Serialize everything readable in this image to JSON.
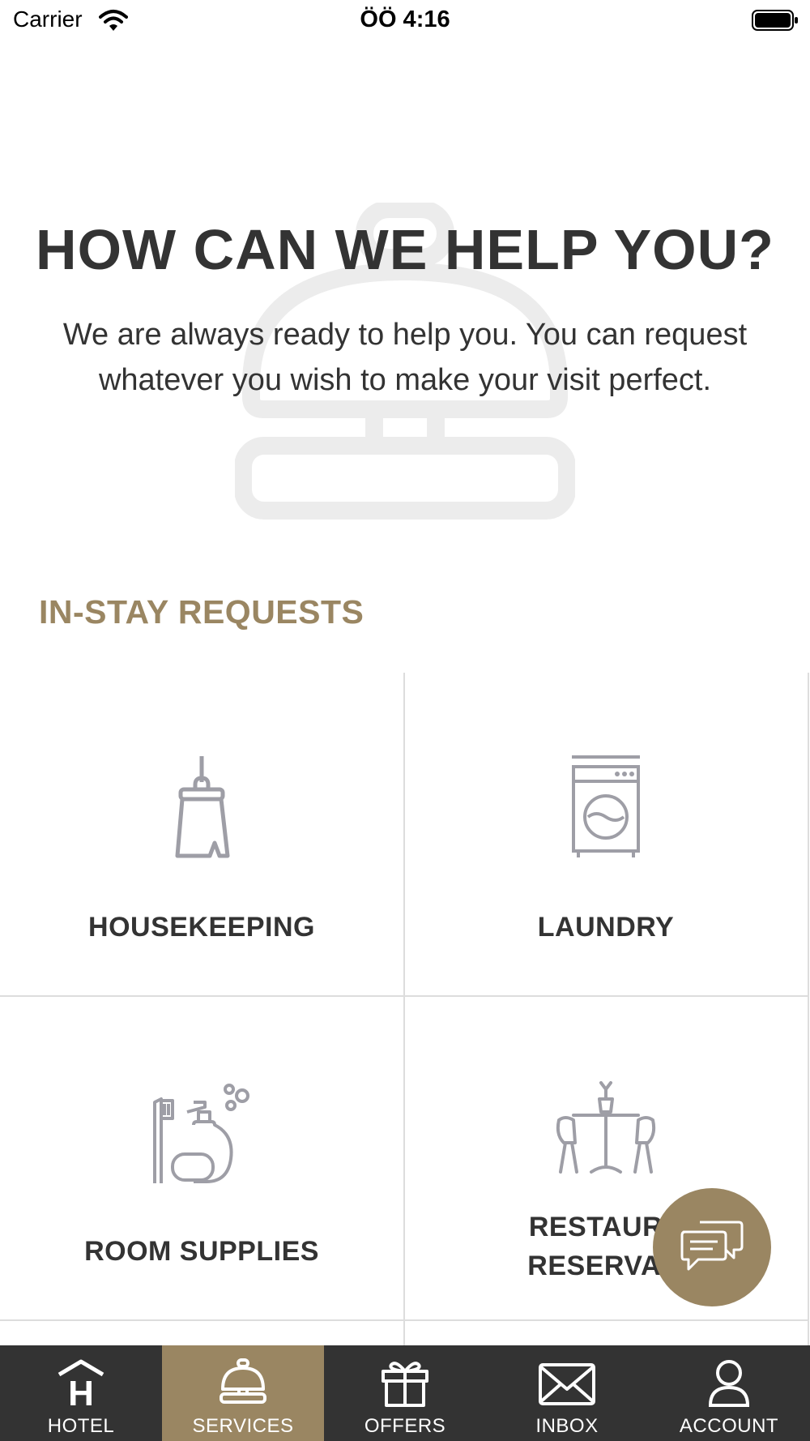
{
  "status_bar": {
    "carrier": "Carrier",
    "time": "ÖÖ 4:16",
    "wifi_icon": "wifi-icon",
    "battery_icon": "battery-icon"
  },
  "hero": {
    "title": "HOW CAN WE HELP YOU?",
    "text": "We are always ready to help you. You can request whatever you wish to make your visit perfect.",
    "background_icon": "service-bell-icon"
  },
  "section": {
    "title": "IN-STAY REQUESTS"
  },
  "tiles": [
    {
      "label": "HOUSEKEEPING",
      "icon": "broom-icon"
    },
    {
      "label": "LAUNDRY",
      "icon": "washing-machine-icon"
    },
    {
      "label": "ROOM SUPPLIES",
      "icon": "toiletries-icon"
    },
    {
      "label": "RESTAURANT RESERVATION",
      "label_line1": "RESTAURA",
      "label_line2": "RESERVATI",
      "icon": "dining-table-icon"
    }
  ],
  "chat_fab": {
    "icon": "chat-bubbles-icon"
  },
  "tab_bar": {
    "items": [
      {
        "label": "HOTEL",
        "icon": "hotel-icon",
        "active": false
      },
      {
        "label": "SERVICES",
        "icon": "service-bell-icon",
        "active": true
      },
      {
        "label": "OFFERS",
        "icon": "gift-icon",
        "active": false
      },
      {
        "label": "INBOX",
        "icon": "envelope-icon",
        "active": false
      },
      {
        "label": "ACCOUNT",
        "icon": "user-icon",
        "active": false
      }
    ]
  },
  "colors": {
    "accent": "#9a8662",
    "text": "#333333",
    "tab_bar_bg": "#333333",
    "divider": "#dddddd",
    "icon_gray": "#9e9ea6"
  }
}
